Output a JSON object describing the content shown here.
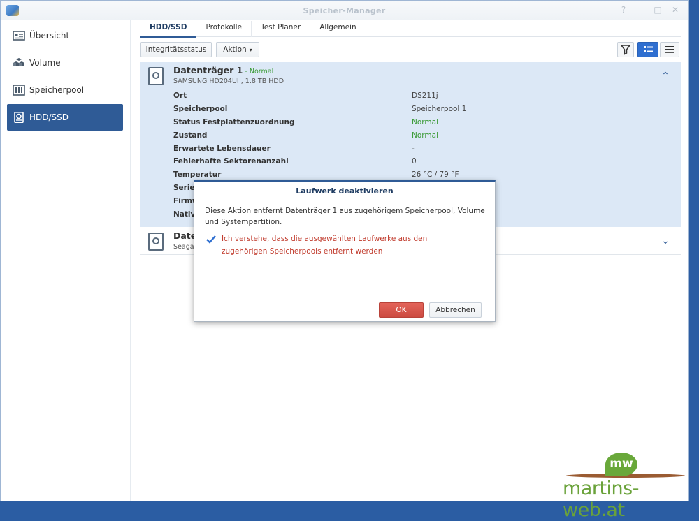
{
  "window": {
    "title": "Speicher-Manager"
  },
  "sidebar": {
    "items": [
      {
        "label": "Übersicht",
        "icon": "overview-icon",
        "active": false
      },
      {
        "label": "Volume",
        "icon": "volume-icon",
        "active": false
      },
      {
        "label": "Speicherpool",
        "icon": "storage-pool-icon",
        "active": false
      },
      {
        "label": "HDD/SSD",
        "icon": "hdd-icon",
        "active": true
      }
    ]
  },
  "tabs": [
    {
      "label": "HDD/SSD",
      "active": true
    },
    {
      "label": "Protokolle",
      "active": false
    },
    {
      "label": "Test Planer",
      "active": false
    },
    {
      "label": "Allgemein",
      "active": false
    }
  ],
  "toolbar": {
    "health_label": "Integritätsstatus",
    "action_label": "Aktion",
    "action_caret": "▾"
  },
  "disks": [
    {
      "name": "Datenträger 1",
      "status_text": " - Normal",
      "model": "SAMSUNG HD204UI , 1.8 TB HDD",
      "expanded": true,
      "properties": [
        {
          "label": "Ort",
          "value": "DS211j"
        },
        {
          "label": "Speicherpool",
          "value": "Speicherpool 1"
        },
        {
          "label": "Status Festplattenzuordnung",
          "value": "Normal",
          "color": "green"
        },
        {
          "label": "Zustand",
          "value": "Normal",
          "color": "green"
        },
        {
          "label": "Erwartete Lebensdauer",
          "value": "-"
        },
        {
          "label": "Fehlerhafte Sektorenanzahl",
          "value": "0"
        },
        {
          "label": "Temperatur",
          "value": "26 °C / 79 °F"
        },
        {
          "label": "Serien",
          "value": ""
        },
        {
          "label": "Firmw",
          "value": ""
        },
        {
          "label": "Native",
          "value": ""
        }
      ]
    },
    {
      "name": "Date",
      "model": "Seagat",
      "expanded": false
    }
  ],
  "dialog": {
    "title": "Laufwerk deaktivieren",
    "message": "Diese Aktion entfernt Datenträger 1 aus zugehörigem Speicherpool, Volume und Systempartition.",
    "checkbox_label": "Ich verstehe, dass die ausgewählten Laufwerke aus den zugehörigen Speicherpools entfernt werden",
    "checkbox_checked": true,
    "ok_label": "OK",
    "cancel_label": "Abbrechen"
  },
  "watermark": {
    "badge": "mw",
    "text": "martins-web.at"
  },
  "colors": {
    "accent": "#2f5b96",
    "ok_red": "#cc4b41",
    "status_green": "#3a9a35",
    "warning_text": "#c0392b"
  }
}
